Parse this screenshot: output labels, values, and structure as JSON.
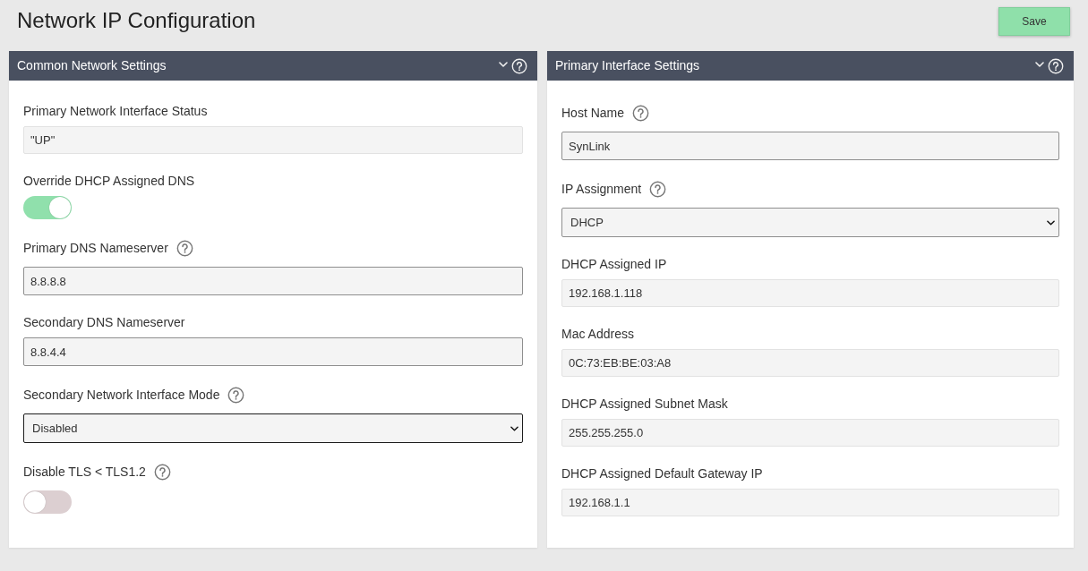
{
  "page": {
    "title": "Network IP Configuration"
  },
  "save_button": {
    "label": "Save"
  },
  "panels": [
    {
      "title": "Common Network Settings",
      "fields": [
        {
          "kind": "readonly",
          "label": "Primary Network Interface Status",
          "help": false,
          "value": "\"UP\"",
          "focused": false
        },
        {
          "kind": "toggle",
          "label": "Override DHCP Assigned DNS",
          "help": false,
          "on": true
        },
        {
          "kind": "input",
          "label": "Primary DNS Nameserver",
          "help": true,
          "value": "8.8.8.8",
          "focused": false
        },
        {
          "kind": "input",
          "label": "Secondary DNS Nameserver",
          "help": false,
          "value": "8.8.4.4",
          "focused": false
        },
        {
          "kind": "select",
          "label": "Secondary Network Interface Mode",
          "help": true,
          "value": "Disabled",
          "focused": true
        },
        {
          "kind": "toggle",
          "label": "Disable TLS < TLS1.2",
          "help": true,
          "on": false
        }
      ]
    },
    {
      "title": "Primary Interface Settings",
      "fields": [
        {
          "kind": "input",
          "label": "Host Name",
          "help": true,
          "value": "SynLink",
          "focused": false
        },
        {
          "kind": "select",
          "label": "IP Assignment",
          "help": true,
          "value": "DHCP",
          "focused": false
        },
        {
          "kind": "readonly",
          "label": "DHCP Assigned IP",
          "help": false,
          "value": "192.168.1.118",
          "focused": false
        },
        {
          "kind": "readonly",
          "label": "Mac Address",
          "help": false,
          "value": "0C:73:EB:BE:03:A8",
          "focused": false
        },
        {
          "kind": "readonly",
          "label": "DHCP Assigned Subnet Mask",
          "help": false,
          "value": "255.255.255.0",
          "focused": false
        },
        {
          "kind": "readonly",
          "label": "DHCP Assigned Default Gateway IP",
          "help": false,
          "value": "192.168.1.1",
          "focused": false
        }
      ]
    }
  ]
}
